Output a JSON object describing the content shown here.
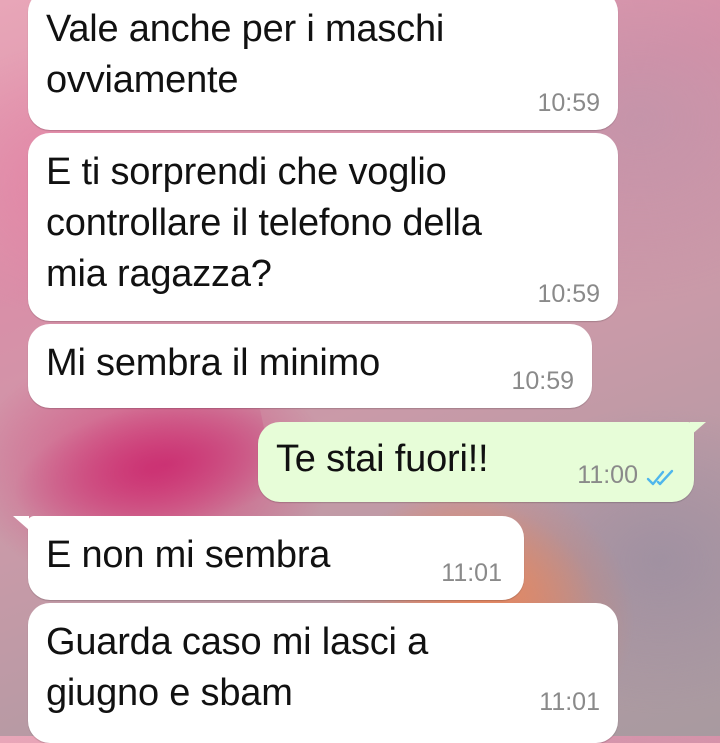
{
  "messages": [
    {
      "text": "Vale anche per i maschi\novviamente",
      "time": "10:59",
      "direction": "incoming"
    },
    {
      "text": "E ti sorprendi che voglio\ncontrollare il telefono della\nmia ragazza?",
      "time": "10:59",
      "direction": "incoming"
    },
    {
      "text": "Mi sembra il minimo",
      "time": "10:59",
      "direction": "incoming"
    },
    {
      "text": "Te stai fuori!!",
      "time": "11:00",
      "direction": "outgoing",
      "status_icon": "double-check-read-icon"
    },
    {
      "text": "E non mi sembra",
      "time": "11:01",
      "direction": "incoming"
    },
    {
      "text": "Guarda caso mi lasci a\ngiugno e sbam",
      "time": "11:01",
      "direction": "incoming"
    }
  ],
  "colors": {
    "incoming_bubble": "#ffffff",
    "outgoing_bubble": "#e7fdd8",
    "timestamp": "#8a8a8a",
    "read_ticks": "#4fb6ec"
  }
}
